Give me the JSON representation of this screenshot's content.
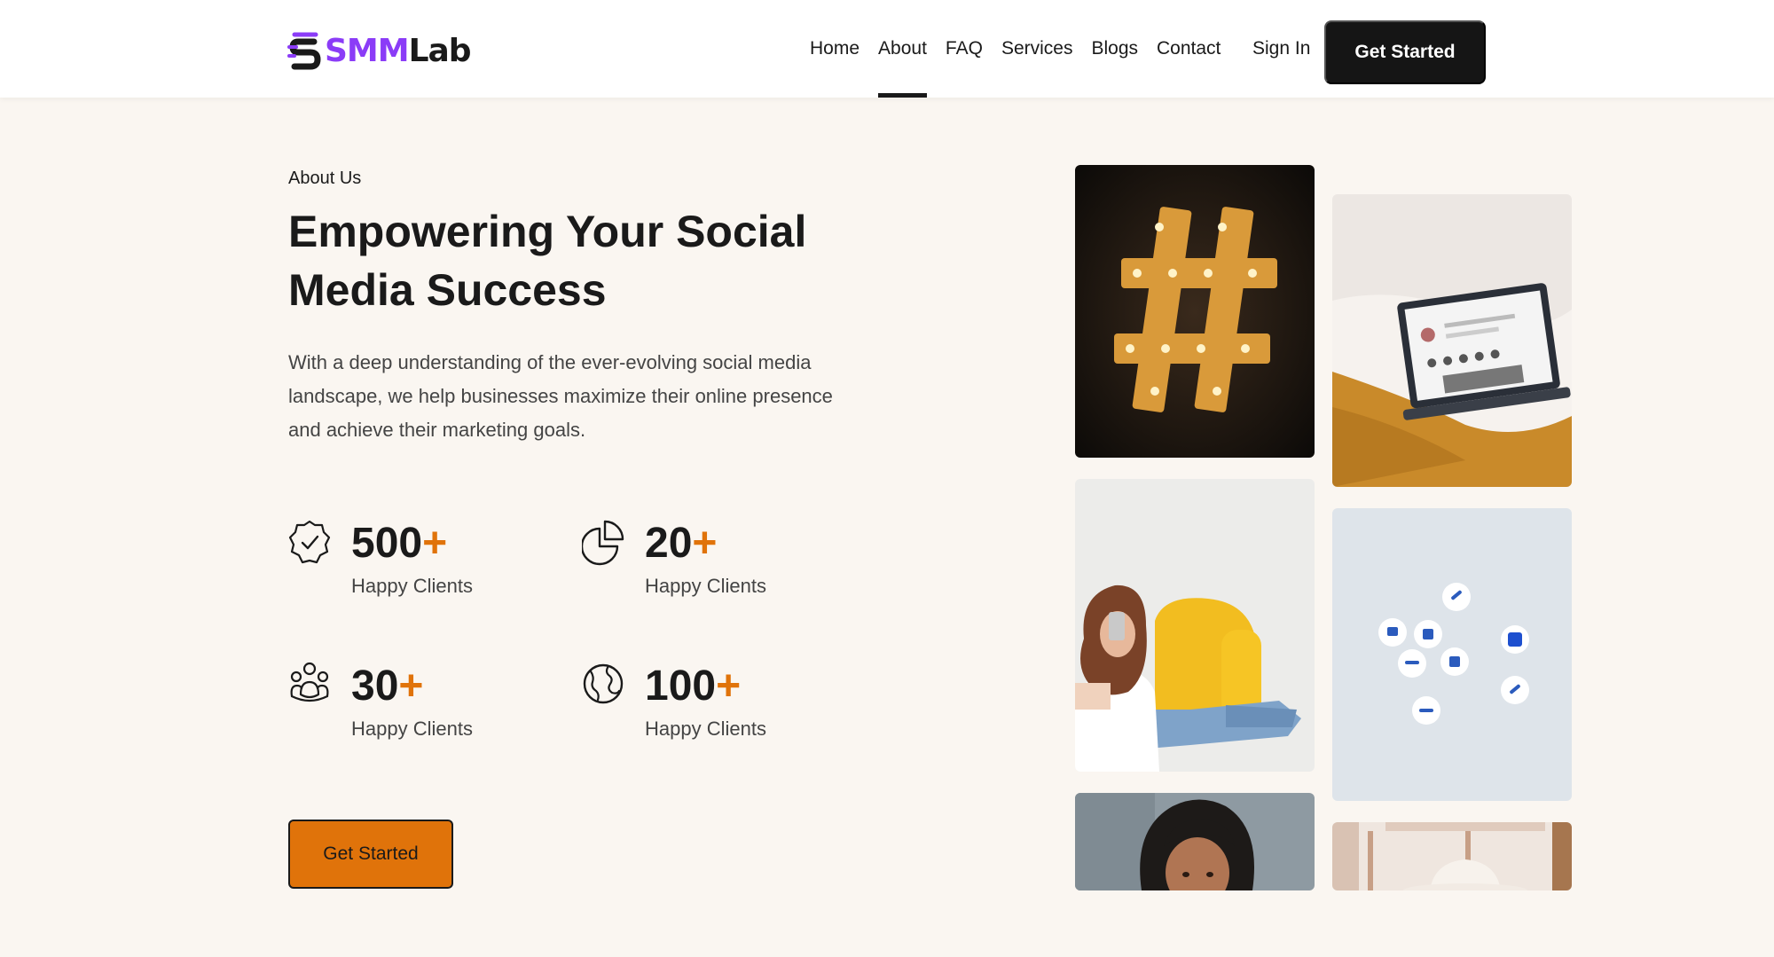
{
  "header": {
    "logo": {
      "part1": "SMM",
      "part2": "Lab"
    },
    "nav": [
      {
        "label": "Home"
      },
      {
        "label": "About",
        "active": true
      },
      {
        "label": "FAQ"
      },
      {
        "label": "Services"
      },
      {
        "label": "Blogs"
      },
      {
        "label": "Contact"
      }
    ],
    "sign_in": "Sign In",
    "cta": "Get Started"
  },
  "hero": {
    "eyebrow": "About Us",
    "title_line1": "Empowering Your Social",
    "title_line2": "Media Success",
    "description": "With a deep understanding of the ever-evolving social media landscape, we help businesses maximize their online presence and achieve their marketing goals.",
    "stats": [
      {
        "icon": "badge-check-icon",
        "value": "500",
        "suffix": "+",
        "label": "Happy Clients"
      },
      {
        "icon": "pie-chart-icon",
        "value": "20",
        "suffix": "+",
        "label": "Happy Clients"
      },
      {
        "icon": "people-group-icon",
        "value": "30",
        "suffix": "+",
        "label": "Happy Clients"
      },
      {
        "icon": "globe-icon",
        "value": "100",
        "suffix": "+",
        "label": "Happy Clients"
      }
    ],
    "cta": "Get Started"
  },
  "gallery": [
    "hashtag-marquee-photo",
    "laptop-on-bed-photo",
    "woman-yellow-chair-photo",
    "social-media-pins-photo",
    "curly-hair-woman-photo",
    "hat-interior-photo"
  ],
  "colors": {
    "brand_purple": "#8b3cf7",
    "accent_orange": "#e0730a",
    "dark": "#151515",
    "hero_bg": "#faf6f1"
  }
}
